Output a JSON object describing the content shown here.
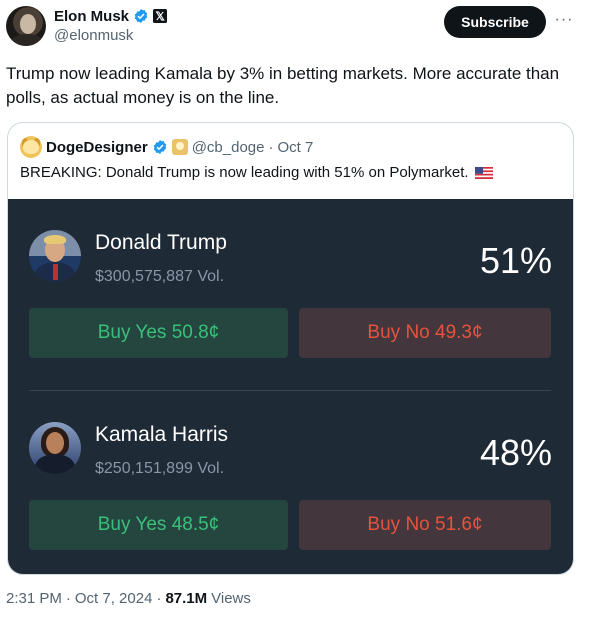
{
  "author": {
    "name": "Elon Musk",
    "handle": "@elonmusk"
  },
  "subscribe_label": "Subscribe",
  "more_label": "···",
  "tweet_text": "Trump now leading Kamala by 3% in betting markets. More accurate than polls, as actual money is on the line.",
  "quote": {
    "name": "DogeDesigner",
    "handle": "@cb_doge",
    "separator": "·",
    "date": "Oct 7",
    "text": "BREAKING: Donald Trump is now leading with 51% on Polymarket."
  },
  "market": {
    "candidates": [
      {
        "name": "Donald Trump",
        "volume": "$300,575,887 Vol.",
        "percent": "51%",
        "buy_yes": "Buy Yes 50.8¢",
        "buy_no": "Buy No 49.3¢"
      },
      {
        "name": "Kamala Harris",
        "volume": "$250,151,899 Vol.",
        "percent": "48%",
        "buy_yes": "Buy Yes 48.5¢",
        "buy_no": "Buy No 51.6¢"
      }
    ]
  },
  "meta": {
    "time": "2:31 PM",
    "separator": "·",
    "date": "Oct 7, 2024",
    "views_count": "87.1M",
    "views_label": "Views"
  },
  "colors": {
    "verified_blue": "#1d9bf0",
    "market_bg": "#1f2a37",
    "yes_text": "#39c07a",
    "no_text": "#e5533d"
  }
}
